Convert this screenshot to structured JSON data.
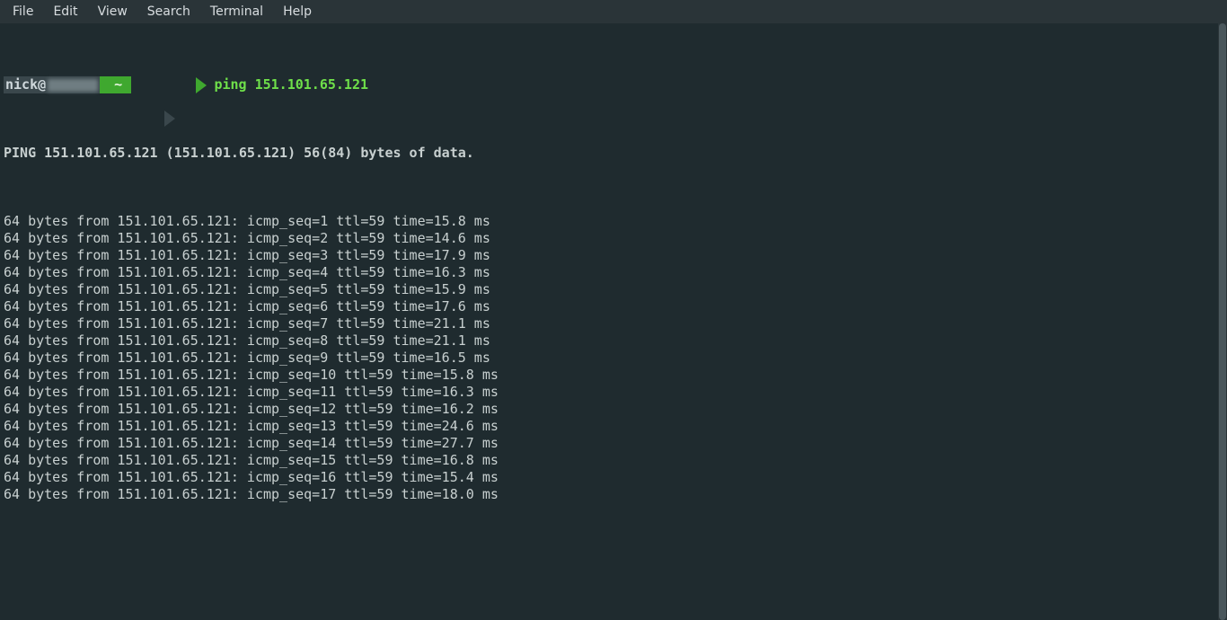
{
  "menu": {
    "items": [
      "File",
      "Edit",
      "View",
      "Search",
      "Terminal",
      "Help"
    ]
  },
  "prompt": {
    "user": "nick@",
    "cwd": "~",
    "command": "ping 151.101.65.121"
  },
  "ping": {
    "header": "PING 151.101.65.121 (151.101.65.121) 56(84) bytes of data.",
    "target": "151.101.65.121",
    "bytes": 64,
    "ttl": 59,
    "replies": [
      {
        "seq": 1,
        "time_ms": 15.8
      },
      {
        "seq": 2,
        "time_ms": 14.6
      },
      {
        "seq": 3,
        "time_ms": 17.9
      },
      {
        "seq": 4,
        "time_ms": 16.3
      },
      {
        "seq": 5,
        "time_ms": 15.9
      },
      {
        "seq": 6,
        "time_ms": 17.6
      },
      {
        "seq": 7,
        "time_ms": 21.1
      },
      {
        "seq": 8,
        "time_ms": 21.1
      },
      {
        "seq": 9,
        "time_ms": 16.5
      },
      {
        "seq": 10,
        "time_ms": 15.8
      },
      {
        "seq": 11,
        "time_ms": 16.3
      },
      {
        "seq": 12,
        "time_ms": 16.2
      },
      {
        "seq": 13,
        "time_ms": 24.6
      },
      {
        "seq": 14,
        "time_ms": 27.7
      },
      {
        "seq": 15,
        "time_ms": 16.8
      },
      {
        "seq": 16,
        "time_ms": 15.4
      },
      {
        "seq": 17,
        "time_ms": 18.0
      }
    ]
  }
}
